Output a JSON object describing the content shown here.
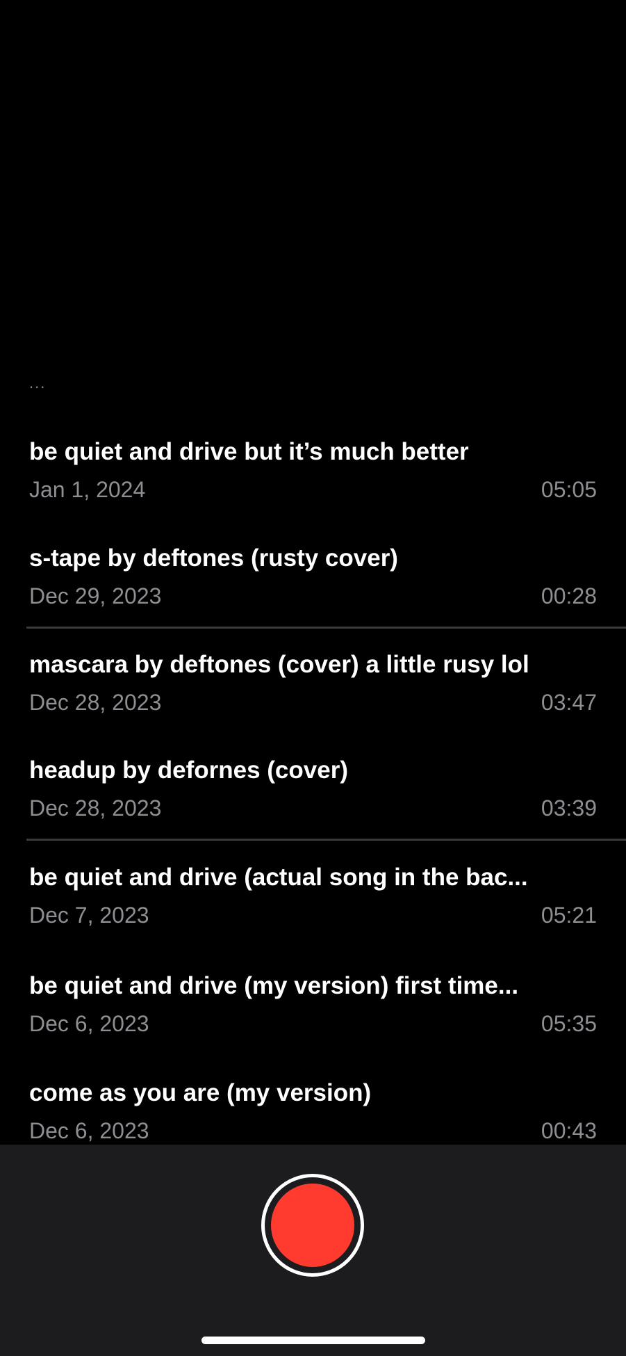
{
  "header": {
    "ellipsis": "..."
  },
  "recordings": [
    {
      "title": "be quiet and drive but it’s much better",
      "date": "Jan 1, 2024",
      "duration": "05:05"
    },
    {
      "title": "s-tape by deftones (rusty cover)",
      "date": "Dec 29, 2023",
      "duration": "00:28"
    },
    {
      "title": "mascara by deftones (cover) a little rusy lol",
      "date": "Dec 28, 2023",
      "duration": "03:47"
    },
    {
      "title": "headup by defornes (cover)",
      "date": "Dec 28, 2023",
      "duration": "03:39"
    },
    {
      "title": "be quiet and drive (actual song in the bac...",
      "date": "Dec 7, 2023",
      "duration": "05:21"
    },
    {
      "title": "be quiet and drive (my version) first time...",
      "date": "Dec 6, 2023",
      "duration": "05:35"
    },
    {
      "title": "come as you are (my version)",
      "date": "Dec 6, 2023",
      "duration": "00:43"
    }
  ],
  "colors": {
    "background": "#000000",
    "bottom_bar": "#1c1c1e",
    "record_button": "#ff3b30",
    "secondary_text": "#8e8e93",
    "divider": "#3a3a3c"
  },
  "icons": {
    "record": "record-icon"
  }
}
